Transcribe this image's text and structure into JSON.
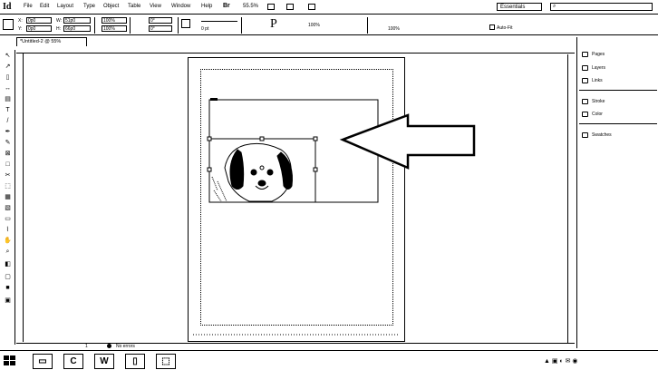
{
  "app": {
    "icon_label": "Id",
    "zoom": "55.5%",
    "workspace": "Essentials"
  },
  "menu": [
    "File",
    "Edit",
    "Layout",
    "Type",
    "Object",
    "Table",
    "View",
    "Window",
    "Help"
  ],
  "control": {
    "x_label": "X:",
    "x_value": "0p0",
    "y_label": "Y:",
    "y_value": "0p0",
    "w_label": "W:",
    "w_value": "51p0",
    "h_label": "H:",
    "h_value": "66p0",
    "scale_x": "100%",
    "scale_y": "100%",
    "angle": "0°",
    "shear": "0°",
    "stroke_weight": "0 pt",
    "opacity": "100%",
    "auto_fit": "Auto-Fit"
  },
  "document": {
    "tab": "*Untitled-2 @ 55%"
  },
  "status": {
    "page": "1",
    "preflight": "No errors"
  },
  "panels": [
    {
      "label": "Pages",
      "icon": "pages-icon"
    },
    {
      "label": "Layers",
      "icon": "layers-icon"
    },
    {
      "label": "Links",
      "icon": "links-icon"
    },
    {
      "label": "Stroke",
      "icon": "stroke-icon"
    },
    {
      "label": "Color",
      "icon": "color-icon"
    },
    {
      "label": "Swatches",
      "icon": "swatches-icon"
    }
  ],
  "taskbar": [
    "Explorer",
    "Chrome",
    "Word",
    "InDesign",
    "Paint"
  ],
  "colors": {
    "ink": "#000000",
    "paper": "#ffffff"
  }
}
